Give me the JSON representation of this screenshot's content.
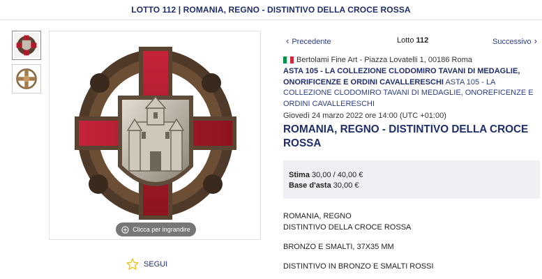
{
  "header": {
    "title": "LOTTO 112 | ROMANIA, REGNO - DISTINTIVO DELLA CROCE ROSSA"
  },
  "gallery": {
    "thumbnails": [
      "thumb-front",
      "thumb-back"
    ],
    "zoom_label": "Clicca per ingrandire",
    "follow_label": "SEGUI"
  },
  "nav": {
    "prev_label": "Precedente",
    "lot_prefix": "Lotto",
    "lot_number": "112",
    "next_label": "Successivo"
  },
  "auction": {
    "house": "Bertolami Fine Art - Piazza Lovatelli 1, 00186 Roma",
    "sale_title_bold": "ASTA 105 - LA COLLEZIONE CLODOMIRO TAVANI DI MEDAGLIE, ONORIFICENZE E ORDINI CAVALLERESCHI",
    "sale_title_rest": " ASTA 105 - LA COLLEZIONE CLODOMIRO TAVANI DI MEDAGLIE, ONOREFICENZE E ORDINI CAVALLERESCHI",
    "date": "Giovedì 24 marzo 2022 ore 14:00 (UTC +01:00)",
    "lot_title": "ROMANIA, REGNO - DISTINTIVO DELLA CROCE ROSSA"
  },
  "estimate": {
    "stima_label": "Stima",
    "stima_value": "30,00 / 40,00 €",
    "base_label": "Base d'asta",
    "base_value": "30,00 €"
  },
  "description": {
    "line1": "ROMANIA, REGNO",
    "line2": "DISTINTIVO DELLA CROCE ROSSA",
    "line3": "BRONZO E SMALTI, 37X35 MM",
    "line4": "DISTINTIVO IN BRONZO E SMALTI ROSSI"
  },
  "colors": {
    "brand": "#1f2d6b",
    "link": "#2c3e86",
    "enamel": "#b3192a",
    "bronze": "#6b4a2e",
    "silver": "#b7b0a3"
  },
  "icons": {
    "prev": "chevron-left-icon",
    "next": "chevron-right-icon",
    "zoom": "zoom-circle-icon",
    "follow": "star-outline-icon",
    "flag": "italy-flag-icon"
  }
}
